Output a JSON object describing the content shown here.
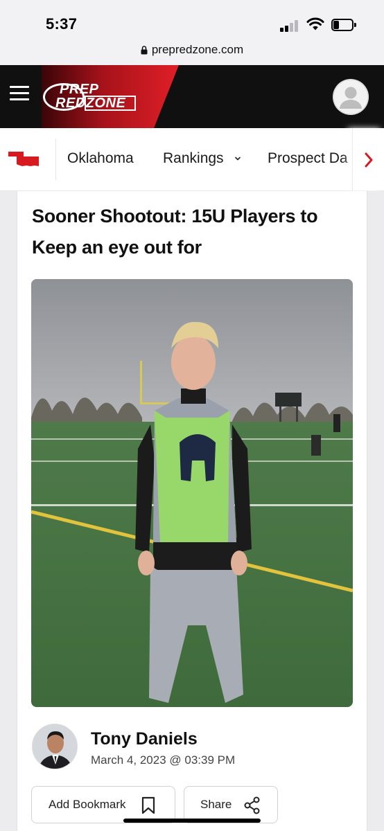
{
  "status_bar": {
    "time": "5:37"
  },
  "browser": {
    "url": "prepredzone.com"
  },
  "header": {
    "logo_line1": "PREP",
    "logo_line2": "REDZONE",
    "brand_color": "#d71920"
  },
  "nav": {
    "state_icon": "oklahoma-state-icon",
    "items": [
      {
        "label": "Oklahoma"
      },
      {
        "label": "Rankings"
      },
      {
        "label": "Prospect Da"
      }
    ]
  },
  "article": {
    "title": "Sooner Shootout: 15U Players to Keep an eye out for",
    "image_alt": "",
    "author": {
      "name": "Tony Daniels",
      "date": "March 4, 2023 @ 03:39 PM"
    },
    "actions": {
      "bookmark_label": "Add Bookmark",
      "share_label": "Share"
    }
  }
}
